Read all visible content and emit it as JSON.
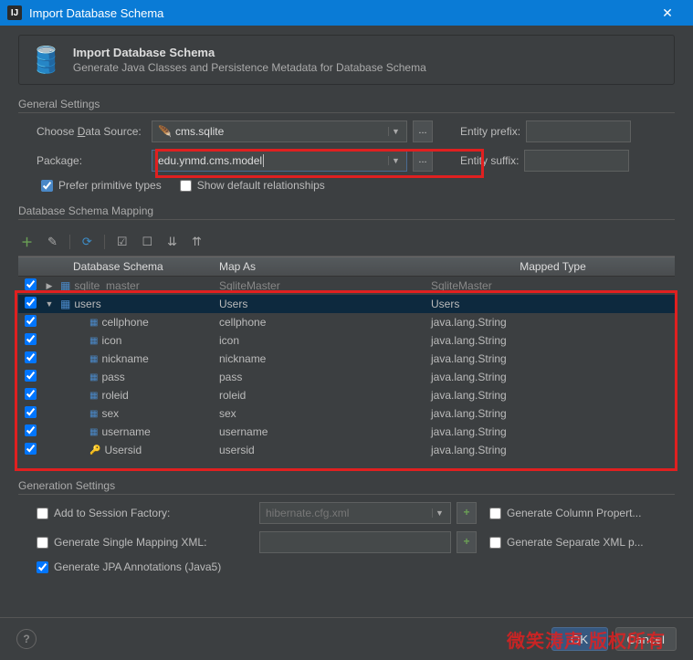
{
  "window": {
    "title": "Import Database Schema"
  },
  "header": {
    "title": "Import Database Schema",
    "desc": "Generate Java Classes and Persistence Metadata for Database Schema"
  },
  "sections": {
    "general": "General Settings",
    "mapping": "Database Schema Mapping",
    "generation": "Generation Settings"
  },
  "general": {
    "dataSourceLabel": "Choose Data Source:",
    "dataSource": "cms.sqlite",
    "packageLabel": "Package:",
    "package": "edu.ynmd.cms.model",
    "entityPrefixLabel": "Entity prefix:",
    "entityPrefix": "",
    "entitySuffixLabel": "Entity suffix:",
    "entitySuffix": "",
    "preferPrimitive": "Prefer primitive types",
    "showDefaultRel": "Show default relationships"
  },
  "columns": {
    "schema": "Database Schema",
    "mapAs": "Map As",
    "mapped": "Mapped Type"
  },
  "rows": [
    {
      "checked": true,
      "depth": 1,
      "icon": "table",
      "name": "sqlite_master",
      "mapAs": "SqliteMaster",
      "mapped": "SqliteMaster",
      "dim": true,
      "expand": "▶"
    },
    {
      "checked": true,
      "depth": 1,
      "icon": "table",
      "name": "users",
      "mapAs": "Users",
      "mapped": "Users",
      "sel": true,
      "expand": "▼"
    },
    {
      "checked": true,
      "depth": 2,
      "icon": "col",
      "name": "cellphone",
      "mapAs": "cellphone",
      "mapped": "java.lang.String"
    },
    {
      "checked": true,
      "depth": 2,
      "icon": "col",
      "name": "icon",
      "mapAs": "icon",
      "mapped": "java.lang.String"
    },
    {
      "checked": true,
      "depth": 2,
      "icon": "col",
      "name": "nickname",
      "mapAs": "nickname",
      "mapped": "java.lang.String"
    },
    {
      "checked": true,
      "depth": 2,
      "icon": "col",
      "name": "pass",
      "mapAs": "pass",
      "mapped": "java.lang.String"
    },
    {
      "checked": true,
      "depth": 2,
      "icon": "col",
      "name": "roleid",
      "mapAs": "roleid",
      "mapped": "java.lang.String"
    },
    {
      "checked": true,
      "depth": 2,
      "icon": "col",
      "name": "sex",
      "mapAs": "sex",
      "mapped": "java.lang.String"
    },
    {
      "checked": true,
      "depth": 2,
      "icon": "col",
      "name": "username",
      "mapAs": "username",
      "mapped": "java.lang.String"
    },
    {
      "checked": true,
      "depth": 2,
      "icon": "key",
      "name": "Usersid",
      "mapAs": "usersid",
      "mapped": "java.lang.String"
    }
  ],
  "generation": {
    "sessionFactory": "Add to Session Factory:",
    "sessionFile": "hibernate.cfg.xml",
    "singleXml": "Generate Single Mapping XML:",
    "jpa": "Generate JPA Annotations (Java5)",
    "colProps": "Generate Column Propert...",
    "sepXml": "Generate Separate XML p..."
  },
  "buttons": {
    "ok": "OK",
    "cancel": "Cancel"
  },
  "watermark": "微笑涛声 版权所有"
}
